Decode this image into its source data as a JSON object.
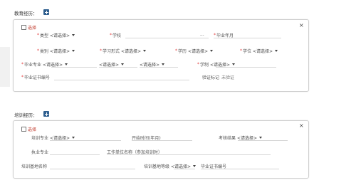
{
  "education": {
    "title": "教育经历：",
    "select_label": "选择",
    "close": "×",
    "placeholder": "<请选择>",
    "type_label": "类型",
    "school_label": "学校",
    "school_more": "...",
    "grad_year_label": "毕业年月",
    "category_label": "类别",
    "study_form_label": "学习形式",
    "education_level_label": "学历",
    "degree_label": "学位",
    "major_label": "毕业专业",
    "program_label": "学制",
    "certificate_no_label": "毕业证书编号",
    "verify_label": "验证标记",
    "verify_value": "未验证"
  },
  "training": {
    "title": "培训经历：",
    "select_label": "选择",
    "close": "×",
    "placeholder": "<请选择>",
    "major_label": "培训专业",
    "start_time_label": "开始时间(年月)",
    "assessment_label": "考核结果",
    "practice_major_label": "执业专业",
    "work_unit_label": "工作单位名称（参加培训时）",
    "base_name_label": "培训基地名称",
    "base_level_label": "培训基地等级",
    "certificate_no_label": "毕业证书编号"
  }
}
